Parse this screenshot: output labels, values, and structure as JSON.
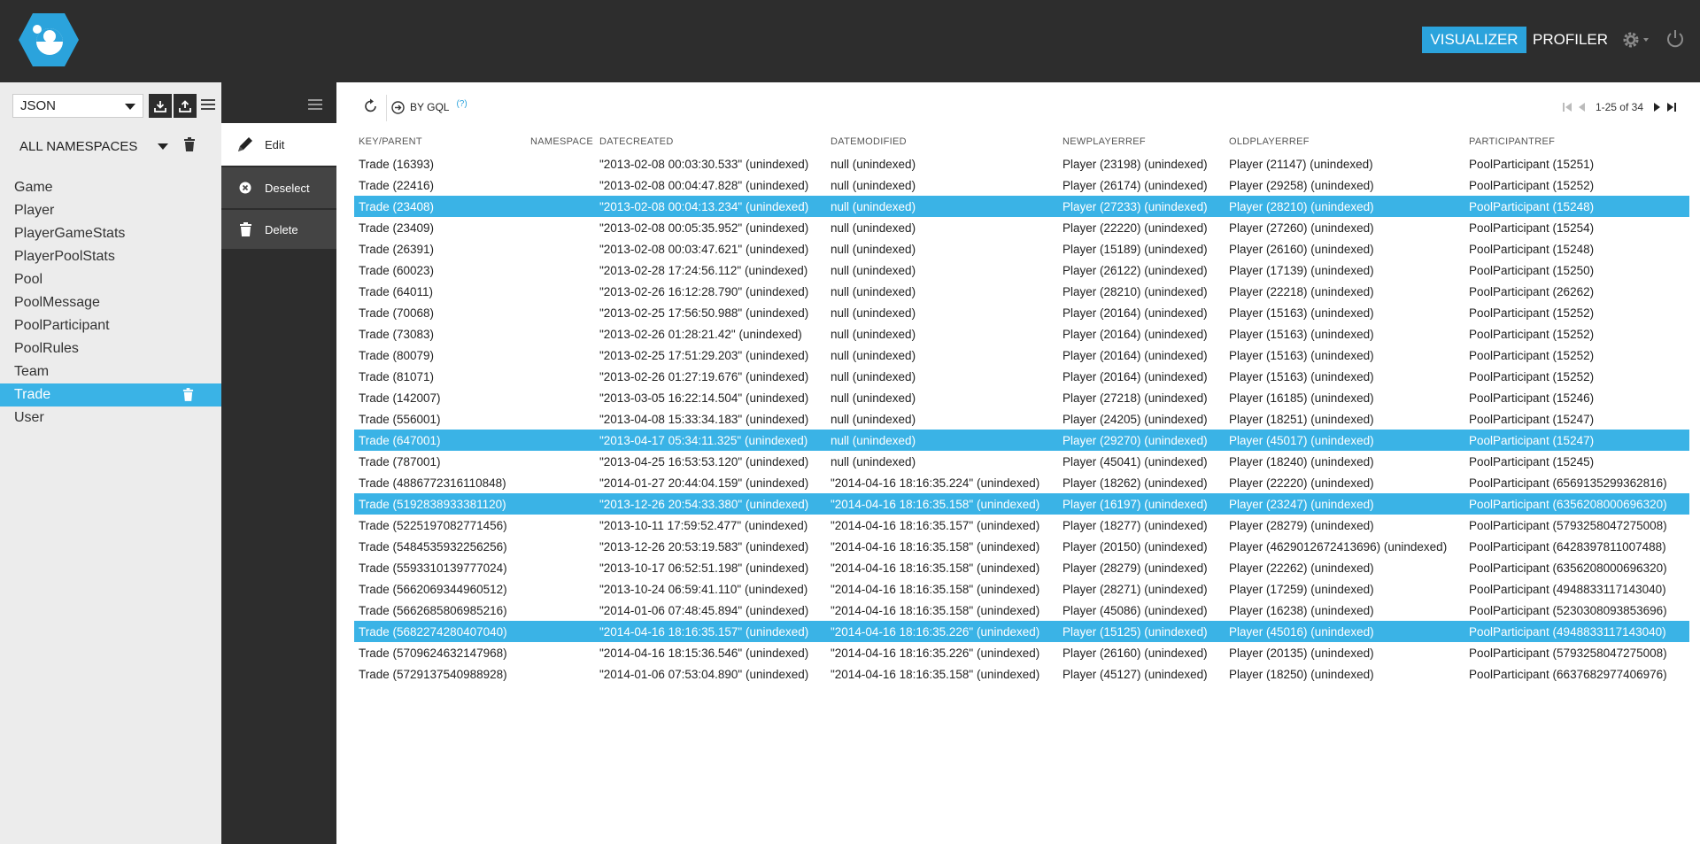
{
  "header": {
    "nav_visualizer": "VISUALIZER",
    "nav_profiler": "PROFILER",
    "brand_color": "#2ba3dc",
    "logo_icon": "datastore-logo-icon",
    "settings_icon": "gear-icon",
    "power_icon": "power-icon"
  },
  "sidebar": {
    "format": "JSON",
    "namespace": "ALL NAMESPACES",
    "kinds": [
      {
        "label": "Game"
      },
      {
        "label": "Player"
      },
      {
        "label": "PlayerGameStats"
      },
      {
        "label": "PlayerPoolStats"
      },
      {
        "label": "Pool"
      },
      {
        "label": "PoolMessage"
      },
      {
        "label": "PoolParticipant"
      },
      {
        "label": "PoolRules"
      },
      {
        "label": "Team"
      },
      {
        "label": "Trade"
      },
      {
        "label": "User"
      }
    ],
    "active_kind": "Trade"
  },
  "actions": {
    "edit": "Edit",
    "deselect": "Deselect",
    "delete": "Delete"
  },
  "toolbar": {
    "gql_label": "BY GQL",
    "gql_help": "(?)",
    "pager_text": "1-25 of 34"
  },
  "table": {
    "columns": [
      "KEY/PARENT",
      "NAMESPACE",
      "DATECREATED",
      "DATEMODIFIED",
      "NEWPLAYERREF",
      "OLDPLAYERREF",
      "PARTICIPANTREF"
    ],
    "rows": [
      {
        "key": "Trade (16393)",
        "ns": "",
        "created": "\"2013-02-08 00:03:30.533\" (unindexed)",
        "modified": "null (unindexed)",
        "newp": "Player (23198) (unindexed)",
        "oldp": "Player (21147) (unindexed)",
        "part": "PoolParticipant (15251)",
        "selected": false
      },
      {
        "key": "Trade (22416)",
        "ns": "",
        "created": "\"2013-02-08 00:04:47.828\" (unindexed)",
        "modified": "null (unindexed)",
        "newp": "Player (26174) (unindexed)",
        "oldp": "Player (29258) (unindexed)",
        "part": "PoolParticipant (15252)",
        "selected": false
      },
      {
        "key": "Trade (23408)",
        "ns": "",
        "created": "\"2013-02-08 00:04:13.234\" (unindexed)",
        "modified": "null (unindexed)",
        "newp": "Player (27233) (unindexed)",
        "oldp": "Player (28210) (unindexed)",
        "part": "PoolParticipant (15248)",
        "selected": true
      },
      {
        "key": "Trade (23409)",
        "ns": "",
        "created": "\"2013-02-08 00:05:35.952\" (unindexed)",
        "modified": "null (unindexed)",
        "newp": "Player (22220) (unindexed)",
        "oldp": "Player (27260) (unindexed)",
        "part": "PoolParticipant (15254)",
        "selected": false
      },
      {
        "key": "Trade (26391)",
        "ns": "",
        "created": "\"2013-02-08 00:03:47.621\" (unindexed)",
        "modified": "null (unindexed)",
        "newp": "Player (15189) (unindexed)",
        "oldp": "Player (26160) (unindexed)",
        "part": "PoolParticipant (15248)",
        "selected": false
      },
      {
        "key": "Trade (60023)",
        "ns": "",
        "created": "\"2013-02-28 17:24:56.112\" (unindexed)",
        "modified": "null (unindexed)",
        "newp": "Player (26122) (unindexed)",
        "oldp": "Player (17139) (unindexed)",
        "part": "PoolParticipant (15250)",
        "selected": false
      },
      {
        "key": "Trade (64011)",
        "ns": "",
        "created": "\"2013-02-26 16:12:28.790\" (unindexed)",
        "modified": "null (unindexed)",
        "newp": "Player (28210) (unindexed)",
        "oldp": "Player (22218) (unindexed)",
        "part": "PoolParticipant (26262)",
        "selected": false
      },
      {
        "key": "Trade (70068)",
        "ns": "",
        "created": "\"2013-02-25 17:56:50.988\" (unindexed)",
        "modified": "null (unindexed)",
        "newp": "Player (20164) (unindexed)",
        "oldp": "Player (15163) (unindexed)",
        "part": "PoolParticipant (15252)",
        "selected": false
      },
      {
        "key": "Trade (73083)",
        "ns": "",
        "created": "\"2013-02-26 01:28:21.42\" (unindexed)",
        "modified": "null (unindexed)",
        "newp": "Player (20164) (unindexed)",
        "oldp": "Player (15163) (unindexed)",
        "part": "PoolParticipant (15252)",
        "selected": false
      },
      {
        "key": "Trade (80079)",
        "ns": "",
        "created": "\"2013-02-25 17:51:29.203\" (unindexed)",
        "modified": "null (unindexed)",
        "newp": "Player (20164) (unindexed)",
        "oldp": "Player (15163) (unindexed)",
        "part": "PoolParticipant (15252)",
        "selected": false
      },
      {
        "key": "Trade (81071)",
        "ns": "",
        "created": "\"2013-02-26 01:27:19.676\" (unindexed)",
        "modified": "null (unindexed)",
        "newp": "Player (20164) (unindexed)",
        "oldp": "Player (15163) (unindexed)",
        "part": "PoolParticipant (15252)",
        "selected": false
      },
      {
        "key": "Trade (142007)",
        "ns": "",
        "created": "\"2013-03-05 16:22:14.504\" (unindexed)",
        "modified": "null (unindexed)",
        "newp": "Player (27218) (unindexed)",
        "oldp": "Player (16185) (unindexed)",
        "part": "PoolParticipant (15246)",
        "selected": false
      },
      {
        "key": "Trade (556001)",
        "ns": "",
        "created": "\"2013-04-08 15:33:34.183\" (unindexed)",
        "modified": "null (unindexed)",
        "newp": "Player (24205) (unindexed)",
        "oldp": "Player (18251) (unindexed)",
        "part": "PoolParticipant (15247)",
        "selected": false
      },
      {
        "key": "Trade (647001)",
        "ns": "",
        "created": "\"2013-04-17 05:34:11.325\" (unindexed)",
        "modified": "null (unindexed)",
        "newp": "Player (29270) (unindexed)",
        "oldp": "Player (45017) (unindexed)",
        "part": "PoolParticipant (15247)",
        "selected": true
      },
      {
        "key": "Trade (787001)",
        "ns": "",
        "created": "\"2013-04-25 16:53:53.120\" (unindexed)",
        "modified": "null (unindexed)",
        "newp": "Player (45041) (unindexed)",
        "oldp": "Player (18240) (unindexed)",
        "part": "PoolParticipant (15245)",
        "selected": false
      },
      {
        "key": "Trade (4886772316110848)",
        "ns": "",
        "created": "\"2014-01-27 20:44:04.159\" (unindexed)",
        "modified": "\"2014-04-16 18:16:35.224\" (unindexed)",
        "newp": "Player (18262) (unindexed)",
        "oldp": "Player (22220) (unindexed)",
        "part": "PoolParticipant (6569135299362816)",
        "selected": false
      },
      {
        "key": "Trade (5192838933381120)",
        "ns": "",
        "created": "\"2013-12-26 20:54:33.380\" (unindexed)",
        "modified": "\"2014-04-16 18:16:35.158\" (unindexed)",
        "newp": "Player (16197) (unindexed)",
        "oldp": "Player (23247) (unindexed)",
        "part": "PoolParticipant (6356208000696320)",
        "selected": true
      },
      {
        "key": "Trade (5225197082771456)",
        "ns": "",
        "created": "\"2013-10-11 17:59:52.477\" (unindexed)",
        "modified": "\"2014-04-16 18:16:35.157\" (unindexed)",
        "newp": "Player (18277) (unindexed)",
        "oldp": "Player (28279) (unindexed)",
        "part": "PoolParticipant (5793258047275008)",
        "selected": false
      },
      {
        "key": "Trade (5484535932256256)",
        "ns": "",
        "created": "\"2013-12-26 20:53:19.583\" (unindexed)",
        "modified": "\"2014-04-16 18:16:35.158\" (unindexed)",
        "newp": "Player (20150) (unindexed)",
        "oldp": "Player (4629012672413696) (unindexed)",
        "part": "PoolParticipant (6428397811007488)",
        "selected": false
      },
      {
        "key": "Trade (5593310139777024)",
        "ns": "",
        "created": "\"2013-10-17 06:52:51.198\" (unindexed)",
        "modified": "\"2014-04-16 18:16:35.158\" (unindexed)",
        "newp": "Player (28279) (unindexed)",
        "oldp": "Player (22262) (unindexed)",
        "part": "PoolParticipant (6356208000696320)",
        "selected": false
      },
      {
        "key": "Trade (5662069344960512)",
        "ns": "",
        "created": "\"2013-10-24 06:59:41.110\" (unindexed)",
        "modified": "\"2014-04-16 18:16:35.158\" (unindexed)",
        "newp": "Player (28271) (unindexed)",
        "oldp": "Player (17259) (unindexed)",
        "part": "PoolParticipant (4948833117143040)",
        "selected": false
      },
      {
        "key": "Trade (5662685806985216)",
        "ns": "",
        "created": "\"2014-01-06 07:48:45.894\" (unindexed)",
        "modified": "\"2014-04-16 18:16:35.158\" (unindexed)",
        "newp": "Player (45086) (unindexed)",
        "oldp": "Player (16238) (unindexed)",
        "part": "PoolParticipant (5230308093853696)",
        "selected": false
      },
      {
        "key": "Trade (5682274280407040)",
        "ns": "",
        "created": "\"2014-04-16 18:16:35.157\" (unindexed)",
        "modified": "\"2014-04-16 18:16:35.226\" (unindexed)",
        "newp": "Player (15125) (unindexed)",
        "oldp": "Player (45016) (unindexed)",
        "part": "PoolParticipant (4948833117143040)",
        "selected": true
      },
      {
        "key": "Trade (5709624632147968)",
        "ns": "",
        "created": "\"2014-04-16 18:15:36.546\" (unindexed)",
        "modified": "\"2014-04-16 18:16:35.226\" (unindexed)",
        "newp": "Player (26160) (unindexed)",
        "oldp": "Player (20135) (unindexed)",
        "part": "PoolParticipant (5793258047275008)",
        "selected": false
      },
      {
        "key": "Trade (5729137540988928)",
        "ns": "",
        "created": "\"2014-01-06 07:53:04.890\" (unindexed)",
        "modified": "\"2014-04-16 18:16:35.158\" (unindexed)",
        "newp": "Player (45127) (unindexed)",
        "oldp": "Player (18250) (unindexed)",
        "part": "PoolParticipant (6637682977406976)",
        "selected": false
      }
    ]
  }
}
